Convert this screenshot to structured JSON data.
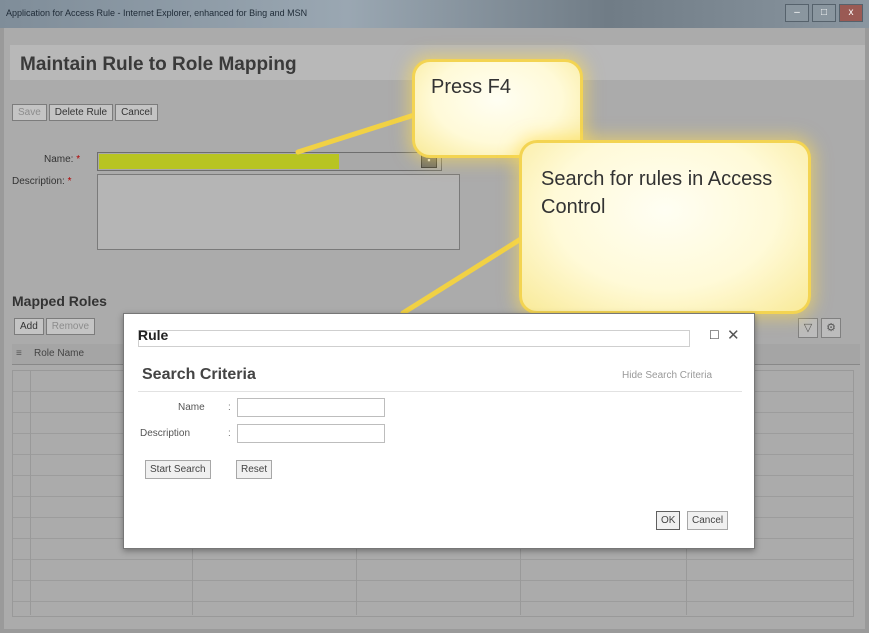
{
  "window": {
    "title": "Application for Access Rule - Internet Explorer, enhanced for Bing and MSN",
    "buttons": [
      "–",
      "□",
      "x"
    ]
  },
  "page": {
    "title": "Maintain Rule to Role Mapping"
  },
  "toolbar": {
    "save": "Save",
    "delete_rule": "Delete Rule",
    "cancel": "Cancel"
  },
  "form": {
    "name_label": "Name:",
    "description_label": "Description:",
    "required": "*"
  },
  "mapped_roles": {
    "title": "Mapped Roles",
    "add": "Add",
    "remove": "Remove",
    "column_role_name": "Role Name"
  },
  "callouts": {
    "press_f4": "Press F4",
    "search_rules": "Search for rules in Access Control"
  },
  "dialog": {
    "title": "Rule",
    "search_criteria": "Search Criteria",
    "hide_search_criteria": "Hide Search Criteria",
    "name_label": "Name",
    "description_label": "Description",
    "colon": ":",
    "start_search": "Start Search",
    "reset": "Reset",
    "ok": "OK",
    "cancel": "Cancel"
  },
  "icons": {
    "filter": "filter-icon",
    "settings": "settings-icon",
    "value_help": "value-help-icon",
    "restore": "restore-icon",
    "close": "close-icon",
    "column": "column-icon"
  },
  "colors": {
    "overlay": "#ababab",
    "highlight_field": "#b8c422",
    "callout_border": "#f3d452"
  }
}
